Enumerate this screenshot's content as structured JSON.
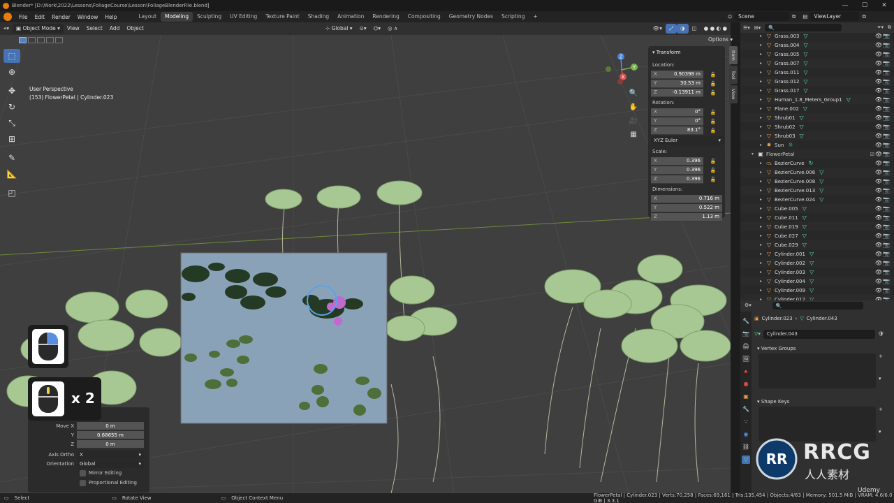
{
  "window": {
    "title": "Blender* [D:\\Work\\2022\\Lessons\\FoliageCourse\\Lesson\\FoliageBlenderFile.blend]"
  },
  "menubar": {
    "items": [
      "File",
      "Edit",
      "Render",
      "Window",
      "Help"
    ],
    "workspaces": [
      "Layout",
      "Modeling",
      "Sculpting",
      "UV Editing",
      "Texture Paint",
      "Shading",
      "Animation",
      "Rendering",
      "Compositing",
      "Geometry Nodes",
      "Scripting"
    ],
    "active_workspace": "Modeling",
    "add_tab": "+",
    "scene": "Scene",
    "view_layer": "ViewLayer"
  },
  "viewport_header": {
    "mode": "Object Mode",
    "menus": [
      "View",
      "Select",
      "Add",
      "Object"
    ],
    "orientation": "Global",
    "options": "Options"
  },
  "viewport": {
    "view_name": "User Perspective",
    "selection_info": "(153) FlowerPetal | Cylinder.023",
    "tools": [
      "select-box",
      "cursor",
      "move",
      "rotate",
      "scale",
      "transform",
      "annotate",
      "measure",
      "add-cube"
    ]
  },
  "transform_panel": {
    "header": "Transform",
    "location_label": "Location:",
    "location": {
      "x": "0.90398 m",
      "y": "30.53 m",
      "z": "-0.13911 m"
    },
    "rotation_label": "Rotation:",
    "rotation": {
      "x": "0°",
      "y": "0°",
      "z": "83.1°"
    },
    "rotation_mode": "XYZ Euler",
    "scale_label": "Scale:",
    "scale": {
      "x": "0.396",
      "y": "0.396",
      "z": "0.396"
    },
    "dimensions_label": "Dimensions:",
    "dimensions": {
      "x": "0.716 m",
      "y": "0.522 m",
      "z": "1.13 m"
    },
    "axis_labels": {
      "x": "X",
      "y": "Y",
      "z": "Z"
    }
  },
  "side_tabs": [
    "Item",
    "Tool",
    "View"
  ],
  "outliner": {
    "rows": [
      {
        "name": "Grass.003",
        "type": "mesh"
      },
      {
        "name": "Grass.004",
        "type": "mesh"
      },
      {
        "name": "Grass.005",
        "type": "mesh"
      },
      {
        "name": "Grass.007",
        "type": "mesh"
      },
      {
        "name": "Grass.011",
        "type": "mesh"
      },
      {
        "name": "Grass.012",
        "type": "mesh"
      },
      {
        "name": "Grass.017",
        "type": "mesh"
      },
      {
        "name": "Human_1.8_Meters_Group1",
        "type": "mesh"
      },
      {
        "name": "Plane.002",
        "type": "mesh"
      },
      {
        "name": "Shrub01",
        "type": "mesh"
      },
      {
        "name": "Shrub02",
        "type": "mesh"
      },
      {
        "name": "Shrub03",
        "type": "mesh"
      },
      {
        "name": "Sun",
        "type": "light"
      },
      {
        "name": "FlowerPetal",
        "type": "collection"
      },
      {
        "name": "BezierCurve",
        "type": "curve"
      },
      {
        "name": "BezierCurve.006",
        "type": "mesh"
      },
      {
        "name": "BezierCurve.008",
        "type": "mesh"
      },
      {
        "name": "BezierCurve.013",
        "type": "mesh"
      },
      {
        "name": "BezierCurve.024",
        "type": "mesh"
      },
      {
        "name": "Cube.005",
        "type": "mesh"
      },
      {
        "name": "Cube.011",
        "type": "mesh"
      },
      {
        "name": "Cube.019",
        "type": "mesh"
      },
      {
        "name": "Cube.027",
        "type": "mesh"
      },
      {
        "name": "Cube.029",
        "type": "mesh"
      },
      {
        "name": "Cylinder.001",
        "type": "mesh"
      },
      {
        "name": "Cylinder.002",
        "type": "mesh"
      },
      {
        "name": "Cylinder.003",
        "type": "mesh"
      },
      {
        "name": "Cylinder.004",
        "type": "mesh"
      },
      {
        "name": "Cylinder.009",
        "type": "mesh"
      },
      {
        "name": "Cylinder.012",
        "type": "mesh"
      }
    ]
  },
  "properties": {
    "breadcrumb_object": "Cylinder.023",
    "breadcrumb_mesh": "Cylinder.043",
    "mesh_name": "Cylinder.043",
    "vertex_groups": "Vertex Groups",
    "shape_keys": "Shape Keys"
  },
  "operator_panel": {
    "move_x_label": "Move X",
    "move_x": "0 m",
    "y_label": "Y",
    "move_y": "0.68655 m",
    "z_label": "Z",
    "move_z": "0 m",
    "axis_ortho_label": "Axis Ortho",
    "axis_ortho": "X",
    "orientation_label": "Orientation",
    "orientation": "Global",
    "mirror_editing": "Mirror Editing",
    "proportional_editing": "Proportional Editing"
  },
  "mouse_overlay": {
    "click_count": "x 2"
  },
  "statusbar": {
    "select": "Select",
    "rotate_view": "Rotate View",
    "context_menu": "Object Context Menu",
    "stats": "FlowerPetal | Cylinder.023 | Verts:70,258 | Faces:69,161 | Tris:135,454 | Objects:4/63 | Memory: 501.5 MiB | VRAM: 4.6/6.0 GiB | 3.3.1"
  },
  "watermark": {
    "brand": "RRCG",
    "subtitle": "人人素材",
    "udemy": "Udemy"
  },
  "colors": {
    "accent": "#4772b3",
    "viewport_bg": "#3f3f3f",
    "panel_bg": "#2b2b2b",
    "mesh_icon": "#5de8a8",
    "object_icon": "#e8a050"
  }
}
